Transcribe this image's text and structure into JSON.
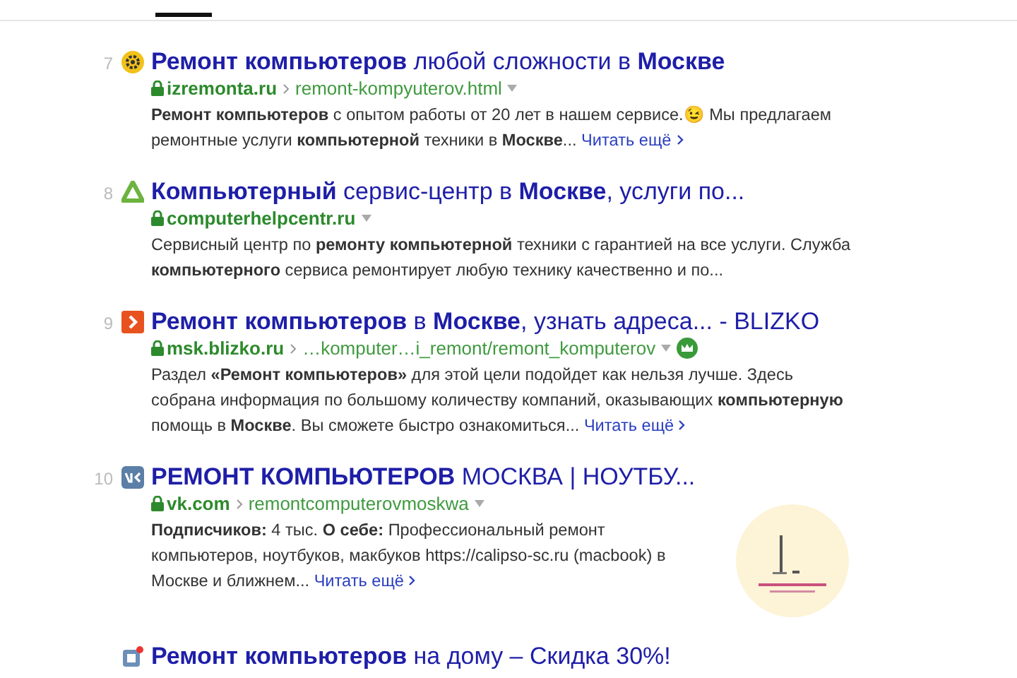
{
  "results": [
    {
      "number": "7",
      "favicon": {
        "kind": "gear"
      },
      "title": "**Ремонт компьютеров** любой сложности в **Москве**",
      "host": "izremonta.ru",
      "path": "remont-kompyuterov.html",
      "snippet": "**Ремонт компьютеров** с опытом работы от 20 лет в нашем сервисе.😉  Мы предлагаем ремонтные услуги **компьютерной** техники в **Москве**...",
      "read_more": "Читать ещё"
    },
    {
      "number": "8",
      "favicon": {
        "kind": "recycle"
      },
      "title": "**Компьютерный** сервис-центр в **Москве**, услуги по...",
      "host": "computerhelpcentr.ru",
      "snippet": "Сервисный центр по **ремонту компьютерной** техники с гарантией на все услуги. Служба **компьютерного** сервиса ремонтирует любую технику качественно и по..."
    },
    {
      "number": "9",
      "favicon": {
        "kind": "chevron"
      },
      "title": "**Ремонт компьютеров** в **Москве**, узнать адреса... - BLIZKO",
      "host": "msk.blizko.ru",
      "path": "…komputer…i_remont/remont_komputerov",
      "badge": {
        "kind": "crown"
      },
      "snippet": "Раздел **«Ремонт компьютеров»** для этой цели подойдет как нельзя лучше. Здесь собрана информация по большому количеству компаний, оказывающих **компьютерную** помощь в **Москве**. Вы сможете быстро ознакомиться...",
      "read_more": "Читать ещё"
    },
    {
      "number": "10",
      "favicon": {
        "kind": "social"
      },
      "title": "**РЕМОНТ КОМПЬЮТЕРОВ** МОСКВА | НОУТБУ...",
      "host": "vk.com",
      "path": "remontcomputerovmoskwa",
      "snippet": "**Подписчиков:** 4 тыс.   **О себе:** Профессиональный ремонт компьютеров, ноутбуков, макбуков https://calipso-sc.ru (macbook) в Москве и ближнем...",
      "read_more": "Читать ещё"
    },
    {
      "favicon": {
        "kind": "ad"
      },
      "title": "**Ремонт компьютеров** на дому – Скидка 30%!"
    }
  ]
}
